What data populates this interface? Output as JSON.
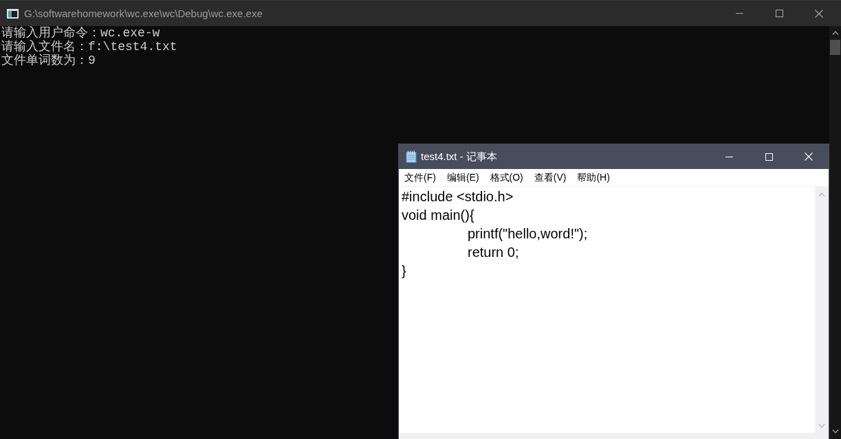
{
  "console_window": {
    "title": "G:\\softwarehomework\\wc.exe\\wc\\Debug\\wc.exe.exe",
    "lines": [
      "请输入用户命令：wc.exe-w",
      "请输入文件名：f:\\test4.txt",
      "文件单词数为：9"
    ]
  },
  "notepad_window": {
    "title": "test4.txt - 记事本",
    "menu": [
      "文件(F)",
      "编辑(E)",
      "格式(O)",
      "查看(V)",
      "帮助(H)"
    ],
    "lines": [
      "#include <stdio.h>",
      "void main(){",
      "\tprintf(\"hello,word!\");",
      "\treturn 0;",
      "}"
    ]
  }
}
